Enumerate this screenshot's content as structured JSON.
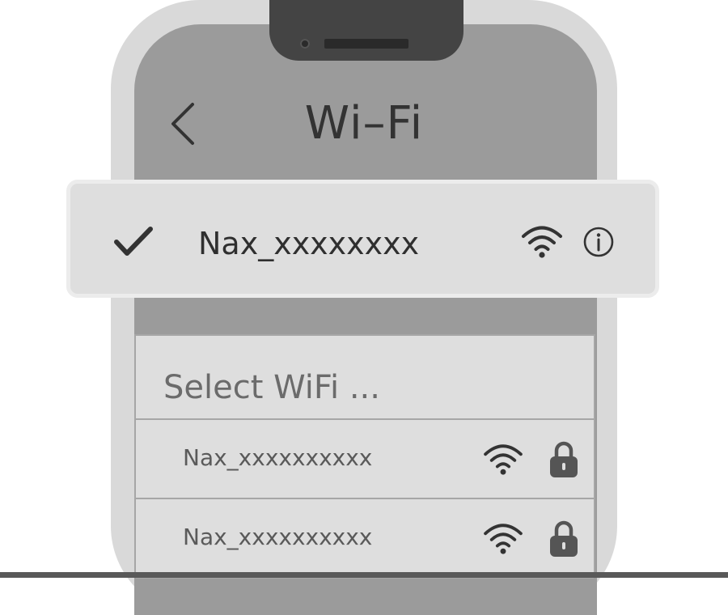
{
  "header": {
    "title": "Wi–Fi",
    "back_icon": "chevron-left-icon"
  },
  "connected_network": {
    "name": "Nax_xxxxxxxx",
    "status_icon": "checkmark-icon",
    "signal_icon": "wifi-icon",
    "info_icon": "info-icon"
  },
  "network_list": {
    "header": "Select WiFi ...",
    "networks": [
      {
        "name": "Nax_xxxxxxxxxx",
        "signal_icon": "wifi-icon",
        "secured_icon": "lock-icon"
      },
      {
        "name": "Nax_xxxxxxxxxx",
        "signal_icon": "wifi-icon",
        "secured_icon": "lock-icon"
      }
    ]
  },
  "colors": {
    "screen_background": "#9b9b9b",
    "bezel": "#d9d9d9",
    "card_background": "#dedede",
    "list_border": "#a6a6a6",
    "icon_color": "#333333",
    "notch": "#444444"
  }
}
